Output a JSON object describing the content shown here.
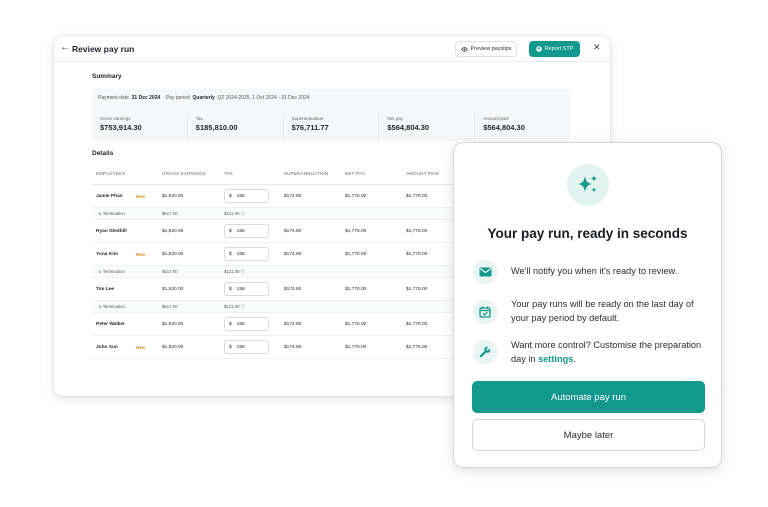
{
  "window": {
    "title": "Review pay run",
    "preview_label": "Preview payslips",
    "report_label": "Report STP"
  },
  "summary": {
    "heading": "Summary",
    "payment_date_label": "Payment date",
    "payment_date": "31 Dec 2024",
    "pay_period_label": "Pay period",
    "pay_period_type": "Quarterly",
    "pay_period_range": "Q2 2024-2025, 1 Oct 2024 - 31 Dec 2024",
    "cards": [
      {
        "label": "Gross earnings",
        "value": "$753,914.30"
      },
      {
        "label": "Tax",
        "value": "$185,810.00"
      },
      {
        "label": "Superannuation",
        "value": "$76,711.77"
      },
      {
        "label": "Net pay",
        "value": "$564,804.30"
      },
      {
        "label": "Amount paid",
        "value": "$564,804.30"
      }
    ]
  },
  "details": {
    "heading": "Details",
    "columns": [
      "EMPLOYEES",
      "GROSS EARNINGS",
      "TAX",
      "SUPERANNUATION",
      "NET PAY",
      "AMOUNT PAID"
    ],
    "rows": [
      {
        "name": "Jamie Phan",
        "badge": "New",
        "gross": "$1,520.00",
        "tax": "158",
        "super": "$174.80",
        "net": "$1,776.00",
        "paid": "$1,776.00"
      },
      {
        "name": "Ryan Gledhill",
        "badge": "",
        "gross": "$1,520.00",
        "tax": "158",
        "super": "$174.80",
        "net": "$1,776.00",
        "paid": "$1,776.00"
      },
      {
        "name": "Yuna Kim",
        "badge": "New",
        "gross": "$1,520.00",
        "tax": "158",
        "super": "$174.80",
        "net": "$1,776.00",
        "paid": "$1,776.00"
      },
      {
        "name": "Tim Lee",
        "badge": "",
        "gross": "$1,520.00",
        "tax": "158",
        "super": "$174.80",
        "net": "$1,776.00",
        "paid": "$1,776.00"
      },
      {
        "name": "Peter Walker",
        "badge": "",
        "gross": "$1,520.00",
        "tax": "158",
        "super": "$174.80",
        "net": "$1,776.00",
        "paid": "$1,776.00"
      },
      {
        "name": "John Sun",
        "badge": "New",
        "gross": "$1,520.00",
        "tax": "158",
        "super": "$174.80",
        "net": "$1,776.00",
        "paid": "$1,776.00"
      }
    ],
    "sub": {
      "label": "Termination",
      "gross": "$517.00",
      "tax": "$121.00"
    },
    "currency": "$"
  },
  "modal": {
    "title": "Your pay run, ready in seconds",
    "feature1": "We'll notify you when it's ready to review.",
    "feature2": "Your pay runs will be ready on the last day of your pay period by default.",
    "feature3_pre": "Want more control? Customise the preparation day in ",
    "feature3_link": "settings",
    "feature3_post": ".",
    "primary_label": "Automate pay run",
    "secondary_label": "Maybe later"
  },
  "colors": {
    "accent": "#12988c",
    "badge": "#d08a1c"
  }
}
